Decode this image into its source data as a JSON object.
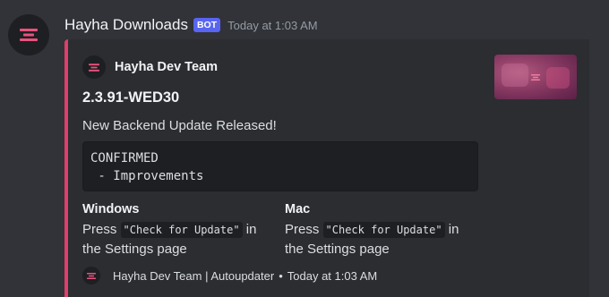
{
  "message": {
    "username": "Hayha Downloads",
    "bot_tag": "BOT",
    "timestamp": "Today at 1:03 AM"
  },
  "embed": {
    "accent_color": "#e03e6b",
    "author_name": "Hayha Dev Team",
    "title": "2.3.91-WED30",
    "description": "New Backend Update Released!",
    "codeblock": [
      "CONFIRMED",
      " - Improvements"
    ],
    "fields": [
      {
        "name": "Windows",
        "value_prefix": "Press ",
        "code": "\"Check for Update\"",
        "value_suffix": " in the Settings page"
      },
      {
        "name": "Mac",
        "value_prefix": "Press ",
        "code": "\"Check for Update\"",
        "value_suffix": " in the Settings page"
      }
    ],
    "footer_text": "Hayha Dev Team | Autoupdater",
    "footer_separator": "•",
    "footer_timestamp": "Today at 1:03 AM",
    "thumbnail_icon": "hayha-logo-icon"
  },
  "colors": {
    "background": "#313338",
    "embed_background": "#2b2d31",
    "logo": "#e8537e",
    "bot_tag": "#5865f2"
  }
}
